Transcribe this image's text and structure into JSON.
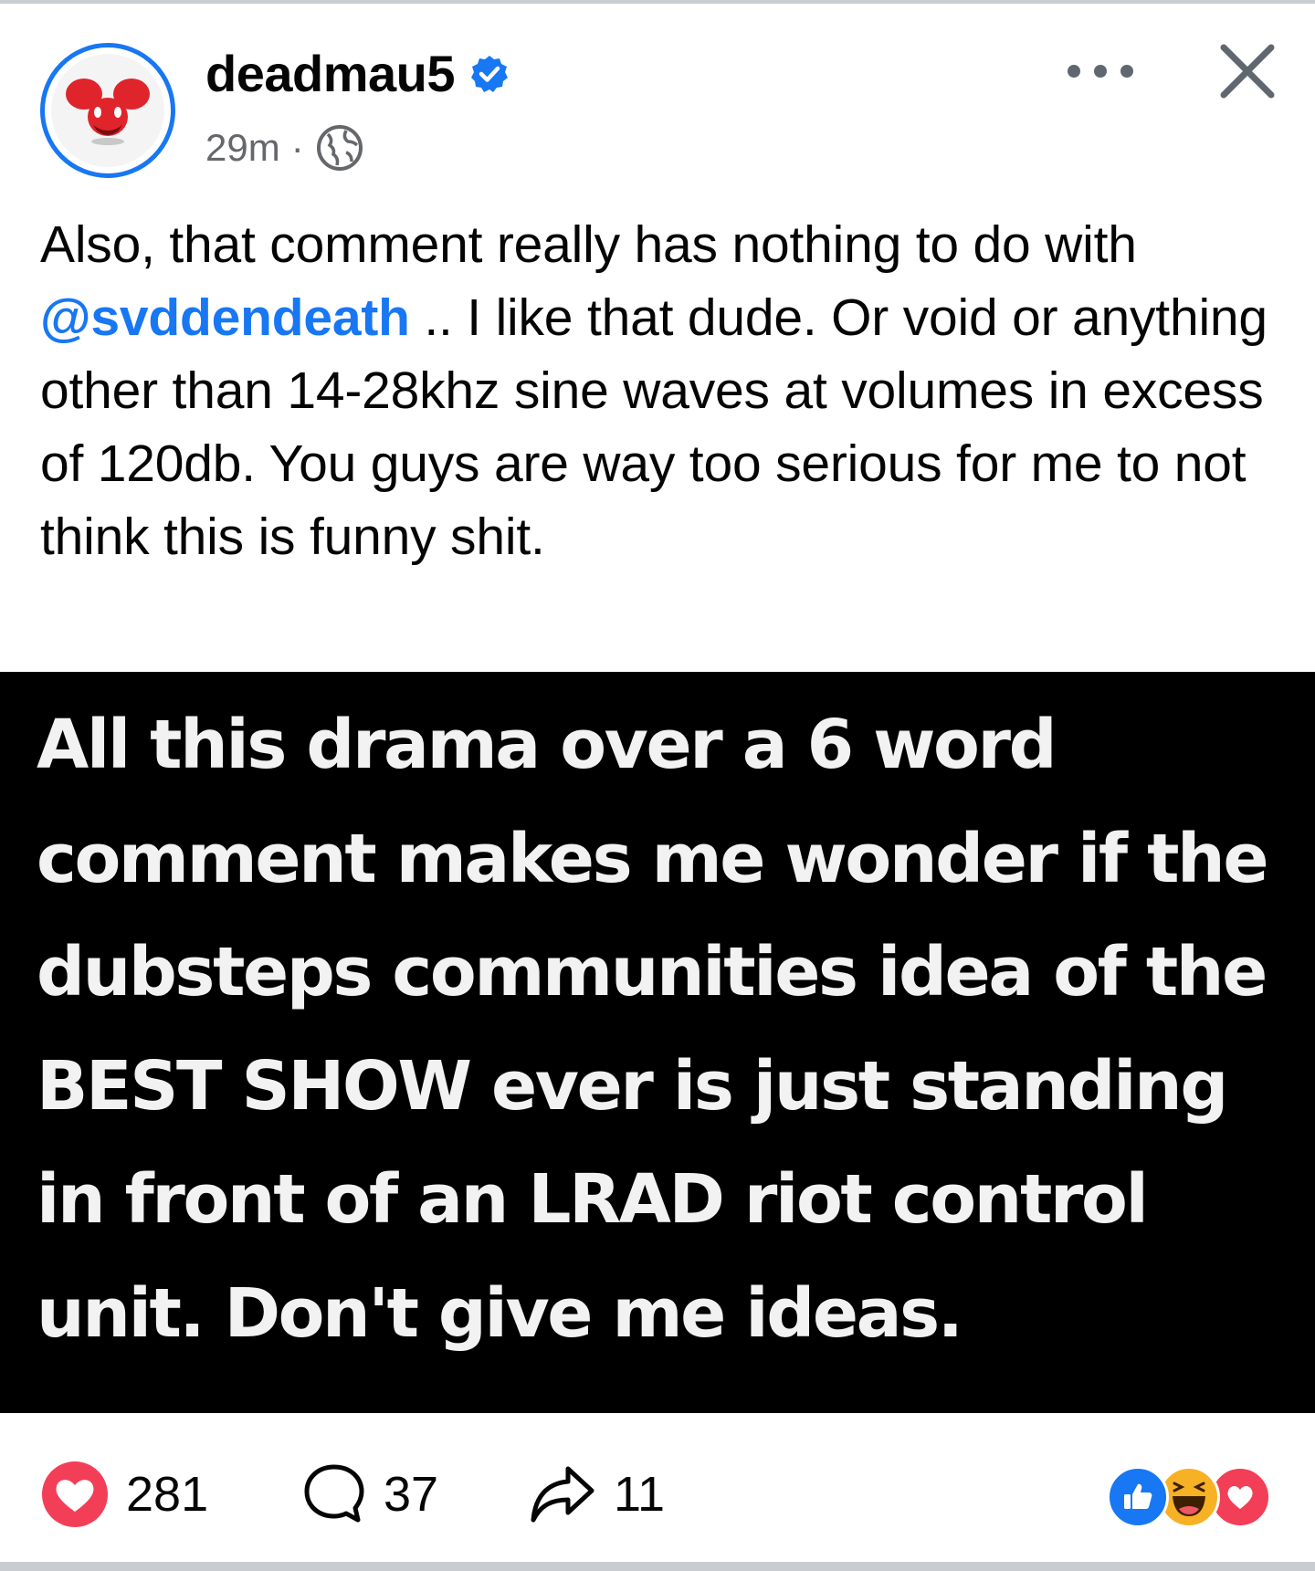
{
  "post": {
    "author": "deadmau5",
    "timestamp": "29m",
    "meta_separator": "·",
    "verified_icon": "verified-badge-icon",
    "privacy_icon": "globe-icon",
    "text_before_mention": "Also, that comment really has nothing to do with ",
    "mention": "@svddendeath",
    "text_after_mention": " .. I like that dude. Or void or anything other than 14-28khz sine waves at volumes in excess of 120db. You guys are way too serious for me to not think this is funny shit.",
    "image_text": "All this drama over a 6 word comment makes me wonder if the dubsteps communities idea of the BEST SHOW ever is just standing in front of an LRAD riot control unit. Don't give me ideas."
  },
  "actions": {
    "more_icon": "more-options-icon",
    "close_icon": "close-icon"
  },
  "footer": {
    "likes": "281",
    "comments": "37",
    "shares": "11",
    "reaction_icons": [
      "like-reaction-icon",
      "haha-reaction-icon",
      "love-reaction-icon"
    ]
  },
  "colors": {
    "accent": "#1877f2",
    "love": "#f33e58",
    "haha": "#f7b125",
    "secondary_text": "#65676b"
  }
}
